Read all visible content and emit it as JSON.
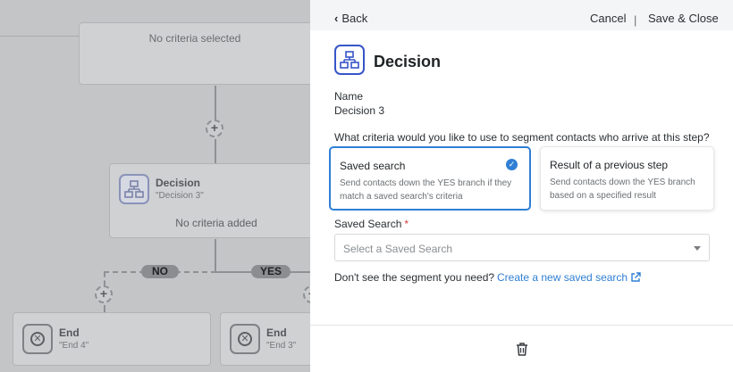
{
  "canvas": {
    "top_card": {
      "empty_text": "No criteria selected"
    },
    "decision_node": {
      "title": "Decision",
      "subtitle": "\"Decision 3\"",
      "empty_text": "No criteria added"
    },
    "branches": {
      "no_label": "NO",
      "yes_label": "YES"
    },
    "end_nodes": [
      {
        "title": "End",
        "subtitle": "\"End 4\""
      },
      {
        "title": "End",
        "subtitle": "\"End 3\""
      }
    ]
  },
  "panel": {
    "header": {
      "back_label": "Back",
      "cancel_label": "Cancel",
      "separator": "|",
      "save_close_label": "Save & Close"
    },
    "step_title": "Decision",
    "name_label": "Name",
    "name_value": "Decision 3",
    "criteria_question": "What criteria would you like to use to segment contacts who arrive at this step?",
    "options": [
      {
        "title": "Saved search",
        "description": "Send contacts down the YES branch if they match a saved search's criteria",
        "selected": true
      },
      {
        "title": "Result of a previous step",
        "description": "Send contacts down the YES branch based on a specified result",
        "selected": false
      }
    ],
    "saved_search": {
      "label": "Saved Search",
      "required_mark": "*",
      "placeholder": "Select a Saved Search"
    },
    "segment_prompt": "Don't see the segment you need?",
    "create_link": "Create a new saved search"
  },
  "colors": {
    "accent": "#2f7fd4",
    "icon_blue": "#3655c8",
    "required": "#d23b3b"
  }
}
